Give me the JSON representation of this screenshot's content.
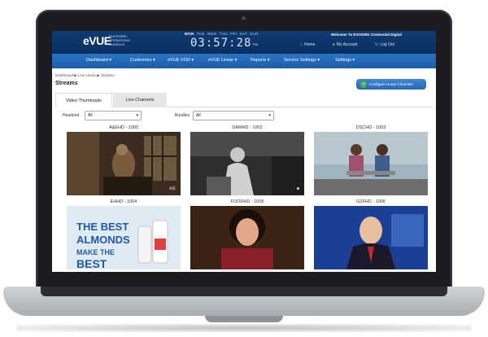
{
  "header": {
    "logo": "eVUE",
    "logo_sub": "PLATFORM OPERATIONS CONSOLE",
    "days": [
      "MON",
      "TUE",
      "WED",
      "THU",
      "FRI",
      "SAT",
      "SUN"
    ],
    "active_day": "MON",
    "clock": "03:57:28",
    "ampm": "PM",
    "welcome": "Welcome To EVOOMG Centennial Digital",
    "links": [
      {
        "icon": "home-icon",
        "label": "Home"
      },
      {
        "icon": "user-icon",
        "label": "My Account"
      },
      {
        "icon": "logout-icon",
        "label": "Log Out"
      }
    ]
  },
  "nav": {
    "items": [
      "Dashboard ▾",
      "Customers ▾",
      "eVUE VOD ▾",
      "eVUE Linear ▾",
      "Reports ▾",
      "Service Settings ▾",
      "Settings ▾"
    ],
    "active": "Dashboard ▾"
  },
  "page": {
    "breadcrumb": "Dashboard ▶ Live Linear ▶ Streams",
    "title": "Streams",
    "configure_button": "Configure Linear Channels",
    "tabs": [
      "Video Thumbnails",
      "Live Channels"
    ],
    "active_tab": "Video Thumbnails",
    "filters": {
      "headend_label": "Headend",
      "headend_value": "All",
      "bundles_label": "Bundles",
      "bundles_value": "All"
    }
  },
  "thumbnails": [
    {
      "label": "A&EHD - 1000",
      "badge": "A|E"
    },
    {
      "label": "DAMHD - 1002",
      "badge": "◙"
    },
    {
      "label": "DSCHD - 1003",
      "badge": ""
    },
    {
      "label": "EHHD - 1004",
      "badge": ""
    },
    {
      "label": "FOODHD - 1005",
      "badge": ""
    },
    {
      "label": "G2FHD - 1006",
      "badge": ""
    }
  ]
}
